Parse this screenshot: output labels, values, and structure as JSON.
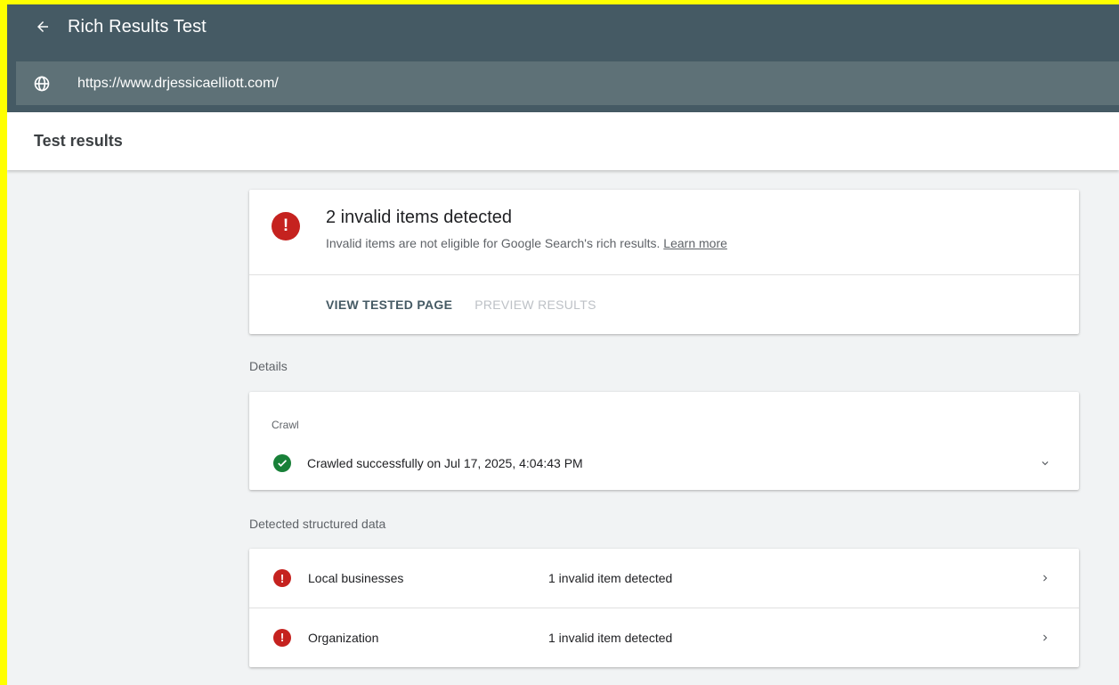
{
  "app": {
    "title": "Rich Results Test",
    "url": "https://www.drjessicaelliott.com/"
  },
  "results_header": {
    "title": "Test results"
  },
  "summary": {
    "title": "2 invalid items detected",
    "subtitle": "Invalid items are not eligible for Google Search's rich results.",
    "learn_more": "Learn more",
    "actions": {
      "view_tested_page": "VIEW TESTED PAGE",
      "preview_results": "PREVIEW RESULTS"
    }
  },
  "details": {
    "label": "Details",
    "crawl_caption": "Crawl",
    "crawl_status": "Crawled successfully on Jul 17, 2025, 4:04:43 PM"
  },
  "structured_data": {
    "label": "Detected structured data",
    "items": [
      {
        "name": "Local businesses",
        "status": "1 invalid item detected"
      },
      {
        "name": "Organization",
        "status": "1 invalid item detected"
      }
    ]
  },
  "colors": {
    "appbar": "#455a64",
    "error": "#c5221f",
    "success": "#188038",
    "highlight_border": "#ffff00"
  },
  "icons": {
    "back": "arrow-back-icon",
    "globe": "globe-icon",
    "error": "error-icon",
    "success": "check-circle-icon",
    "expand": "chevron-down-icon",
    "open": "chevron-right-icon"
  }
}
